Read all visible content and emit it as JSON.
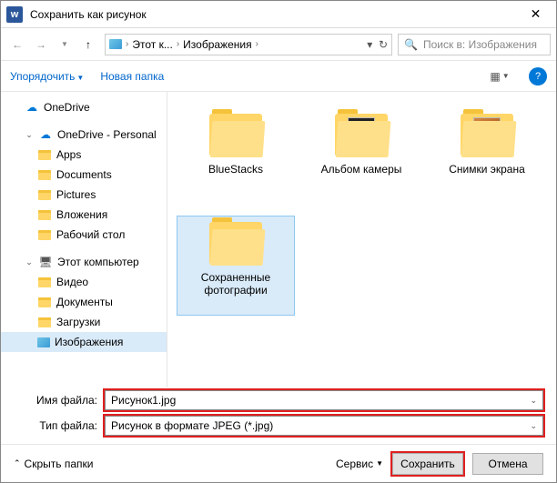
{
  "title": "Сохранить как рисунок",
  "breadcrumb": {
    "seg1": "Этот к...",
    "seg2": "Изображения"
  },
  "search_placeholder": "Поиск в: Изображения",
  "toolbar": {
    "organize": "Упорядочить",
    "new_folder": "Новая папка"
  },
  "tree": {
    "onedrive": "OneDrive",
    "onedrive_personal": "OneDrive - Personal",
    "apps": "Apps",
    "documents": "Documents",
    "pictures": "Pictures",
    "attachments": "Вложения",
    "desktop": "Рабочий стол",
    "this_pc": "Этот компьютер",
    "video": "Видео",
    "docs_ru": "Документы",
    "downloads": "Загрузки",
    "images": "Изображения"
  },
  "files": {
    "f1": "BlueStacks",
    "f2": "Альбом камеры",
    "f3": "Снимки экрана",
    "f4": "Сохраненные фотографии"
  },
  "form": {
    "filename_label": "Имя файла:",
    "filename_value": "Рисунок1.jpg",
    "filetype_label": "Тип файла:",
    "filetype_value": "Рисунок в формате JPEG (*.jpg)"
  },
  "footer": {
    "hide": "Скрыть папки",
    "tools": "Сервис",
    "save": "Сохранить",
    "cancel": "Отмена"
  }
}
